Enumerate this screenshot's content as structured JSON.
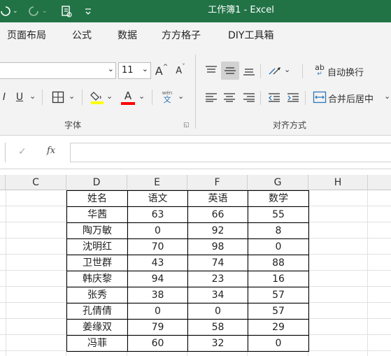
{
  "titlebar": {
    "title": "工作簿1  -  Excel",
    "undo_icon": "undo-icon",
    "redo_icon": "redo-icon",
    "clipboard_icon": "print-preview-icon",
    "customize_icon": "customize-qat-icon"
  },
  "tabs": [
    {
      "label": "页面布局"
    },
    {
      "label": "公式"
    },
    {
      "label": "数据"
    },
    {
      "label": "方方格子"
    },
    {
      "label": "DIY工具箱"
    }
  ],
  "font_group": {
    "label": "字体",
    "font_size": "11",
    "bold_label": "I",
    "underline_label": "U",
    "font_color_label": "A",
    "grow_label": "A",
    "shrink_label": "A",
    "phonetic_top": "wén",
    "phonetic_bottom": "文",
    "fill_color": "#ffff00",
    "font_color": "#ff0000"
  },
  "align_group": {
    "label": "对齐方式",
    "wrap_text": "自动换行",
    "merge_center": "合并后居中",
    "wrap_icon_text": "ab"
  },
  "formula_bar": {
    "fx": "fx",
    "check": "✓"
  },
  "columns": [
    "C",
    "D",
    "E",
    "F",
    "G",
    "H"
  ],
  "table": {
    "headers": [
      "姓名",
      "语文",
      "英语",
      "数学"
    ],
    "rows": [
      [
        "华茜",
        "63",
        "66",
        "55"
      ],
      [
        "陶万敏",
        "0",
        "92",
        "8"
      ],
      [
        "沈明红",
        "70",
        "98",
        "0"
      ],
      [
        "卫世群",
        "43",
        "74",
        "88"
      ],
      [
        "韩庆黎",
        "94",
        "23",
        "16"
      ],
      [
        "张秀",
        "38",
        "34",
        "57"
      ],
      [
        "孔倩倩",
        "0",
        "0",
        "57"
      ],
      [
        "姜缘双",
        "79",
        "58",
        "29"
      ],
      [
        "冯菲",
        "60",
        "32",
        "0"
      ]
    ]
  },
  "colors": {
    "excel_green": "#217346",
    "ribbon_bg": "#f3f3f3"
  }
}
